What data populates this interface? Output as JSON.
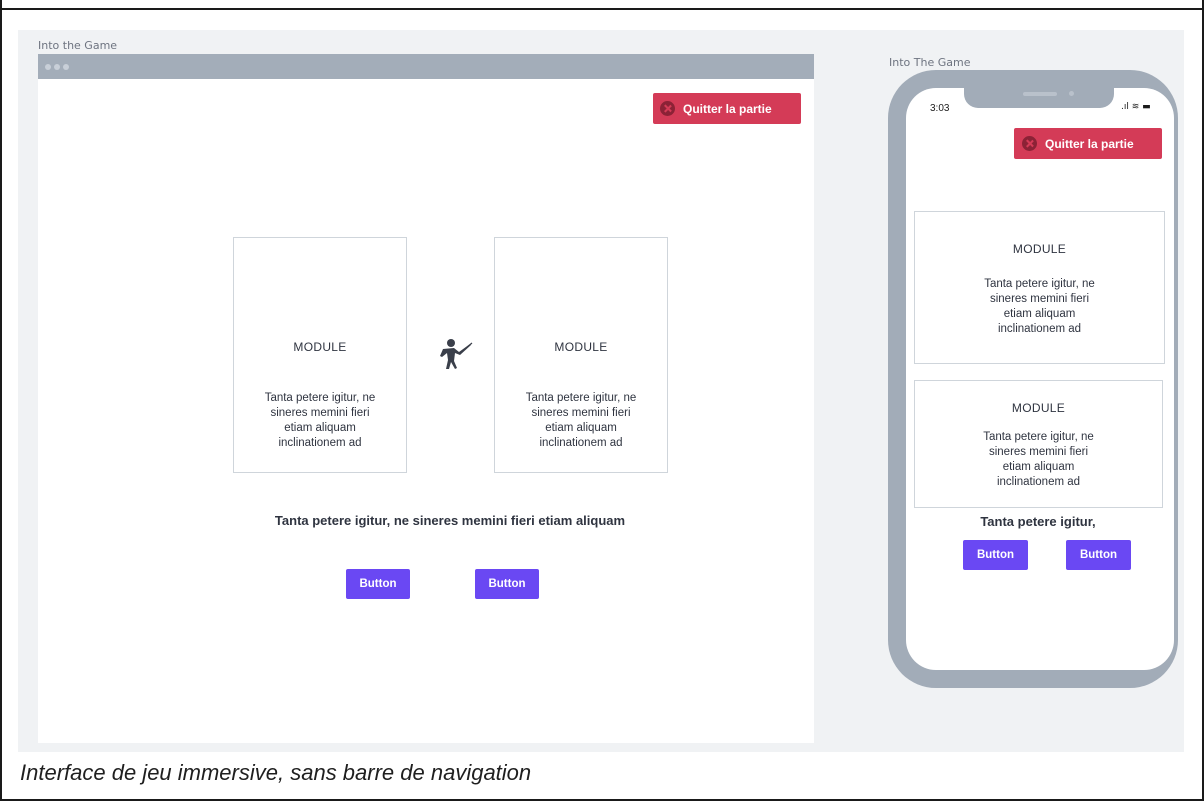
{
  "desktop": {
    "window_title": "Into the Game",
    "quit_button": "Quitter la partie",
    "cards": [
      {
        "title": "MODULE",
        "body": "Tanta petere igitur, ne\nsineres memini fieri\netiam aliquam\ninclinationem ad"
      },
      {
        "title": "MODULE",
        "body": "Tanta petere igitur, ne\nsineres memini fieri\netiam aliquam\ninclinationem ad"
      }
    ],
    "center_icon": "fencer-icon",
    "headline": "Tanta petere igitur, ne sineres memini fieri etiam aliquam",
    "buttons": [
      "Button",
      "Button"
    ]
  },
  "mobile": {
    "window_title": "Into The Game",
    "status_time": "3:03",
    "status_icons": ".ıl ≋ ▬",
    "quit_button": "Quitter la partie",
    "cards": [
      {
        "title": "MODULE",
        "body": "Tanta petere igitur, ne\nsineres memini fieri\netiam aliquam\ninclinationem ad"
      },
      {
        "title": "MODULE",
        "body": "Tanta petere igitur, ne\nsineres memini fieri\netiam aliquam\ninclinationem ad"
      }
    ],
    "headline": "Tanta petere igitur,",
    "buttons": [
      "Button",
      "Button"
    ]
  },
  "caption": "Interface de jeu immersive, sans barre de navigation",
  "colors": {
    "danger": "#d43b57",
    "primary": "#6a48f3",
    "frame": "#a2acb8"
  }
}
